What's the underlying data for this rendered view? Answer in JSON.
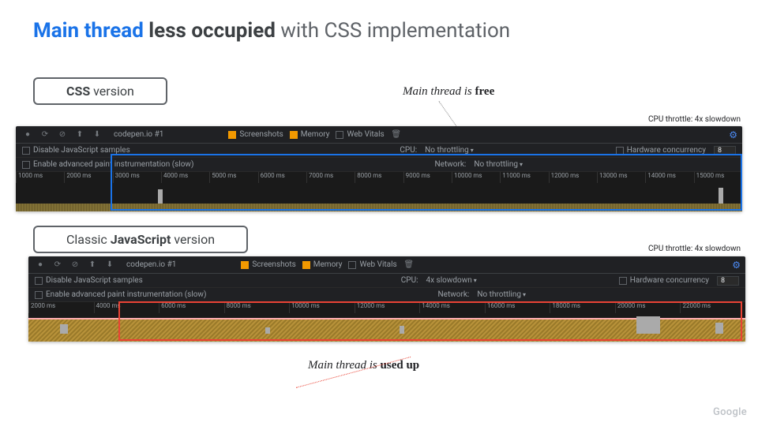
{
  "title": {
    "blue": "Main thread",
    "bold": "less occupied",
    "rest": "with CSS implementation"
  },
  "css_section": {
    "label_prefix": "",
    "label_bold": "CSS",
    "label_suffix": "version",
    "annotation_prefix": "Main thread is ",
    "annotation_bold": "free",
    "throttle": "CPU throttle: 4x slowdown"
  },
  "js_section": {
    "label_prefix": "Classic ",
    "label_bold": "JavaScript",
    "label_suffix": "version",
    "annotation_prefix": "Main thread is ",
    "annotation_bold": "used up",
    "throttle": "CPU throttle: 4x slowdown"
  },
  "devtools": {
    "tab": "codepen.io #1",
    "checks": {
      "screenshots": "Screenshots",
      "memory": "Memory",
      "webvitals": "Web Vitals"
    },
    "row1": {
      "disable_js": "Disable JavaScript samples",
      "cpu_label": "CPU:",
      "cpu_none": "No throttling",
      "cpu_4x": "4x slowdown",
      "hw": "Hardware concurrency",
      "hw_val": "8"
    },
    "row2": {
      "paint": "Enable advanced paint instrumentation (slow)",
      "net_label": "Network:",
      "net_val": "No throttling"
    },
    "ticks_css": [
      "1000 ms",
      "2000 ms",
      "3000 ms",
      "4000 ms",
      "5000 ms",
      "6000 ms",
      "7000 ms",
      "8000 ms",
      "9000 ms",
      "10000 ms",
      "11000 ms",
      "12000 ms",
      "13000 ms",
      "14000 ms",
      "15000 ms"
    ],
    "ticks_js": [
      "2000 ms",
      "4000 ms",
      "6000 ms",
      "8000 ms",
      "10000 ms",
      "12000 ms",
      "14000 ms",
      "16000 ms",
      "18000 ms",
      "20000 ms",
      "22000 ms"
    ]
  },
  "logo": "Google",
  "colors": {
    "blue": "#1a73e8",
    "red": "#ea4335"
  }
}
